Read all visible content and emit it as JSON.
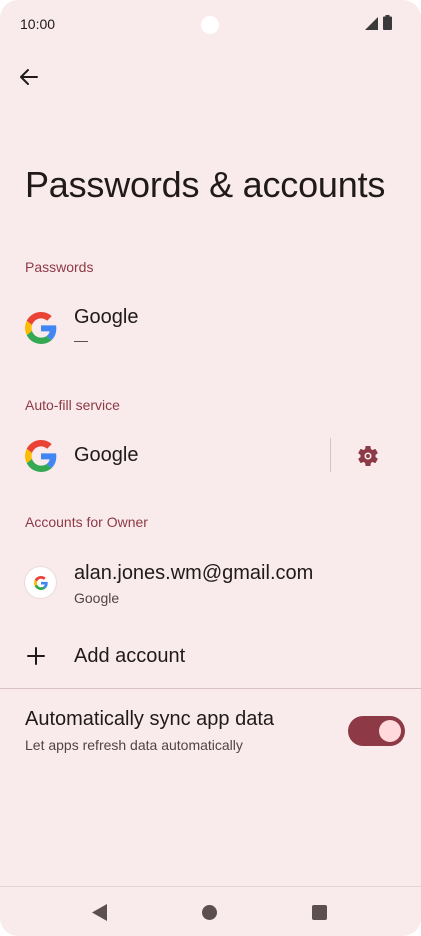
{
  "status_bar": {
    "time": "10:00"
  },
  "page": {
    "title": "Passwords & accounts"
  },
  "passwords": {
    "header": "Passwords",
    "item": {
      "title": "Google",
      "subtitle": "—",
      "icon": "google-logo-icon"
    }
  },
  "autofill": {
    "header": "Auto-fill service",
    "item": {
      "title": "Google",
      "icon": "google-logo-icon",
      "settings_icon": "gear-icon"
    }
  },
  "accounts": {
    "header": "Accounts for Owner",
    "item": {
      "email": "alan.jones.wm@gmail.com",
      "provider": "Google",
      "icon": "google-logo-icon"
    },
    "add_label": "Add account"
  },
  "sync": {
    "title": "Automatically sync app data",
    "subtitle": "Let apps refresh data automatically",
    "enabled": true
  },
  "colors": {
    "background": "#f9ebeb",
    "accent": "#8e3a46",
    "toggle_knob": "#ffd9dc",
    "text_primary": "#201a1b",
    "text_secondary": "#524345"
  }
}
